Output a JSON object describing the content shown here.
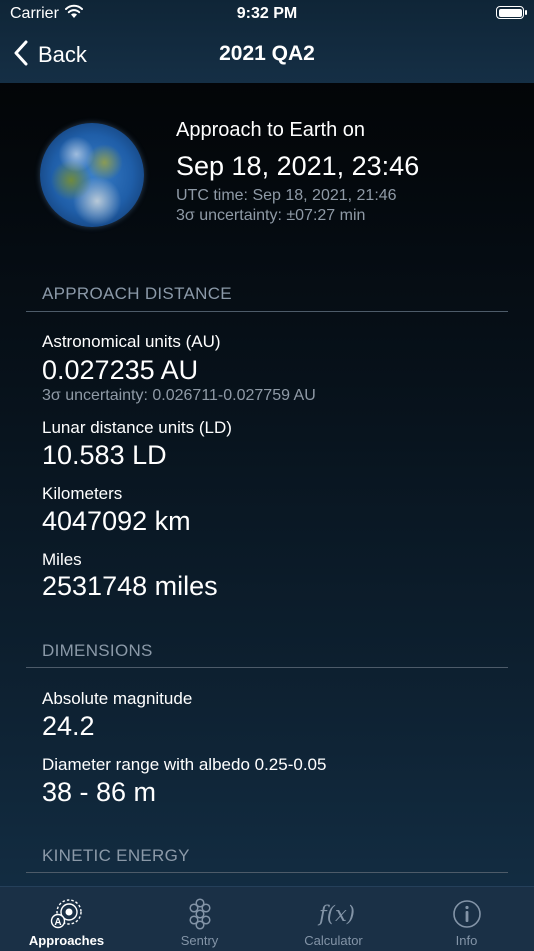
{
  "status_bar": {
    "carrier": "Carrier",
    "time": "9:32 PM"
  },
  "nav": {
    "back_label": "Back",
    "title": "2021 QA2"
  },
  "approach": {
    "label": "Approach to Earth on",
    "date": "Sep 18, 2021, 23:46",
    "utc": "UTC time: Sep 18, 2021, 21:46",
    "uncertainty": "3σ uncertainty: ±07:27 min"
  },
  "sections": {
    "distance": {
      "header": "APPROACH DISTANCE",
      "au_label": "Astronomical units (AU)",
      "au_value": "0.027235 AU",
      "au_uncertainty": "3σ uncertainty: 0.026711-0.027759 AU",
      "ld_label": "Lunar distance units (LD)",
      "ld_value": "10.583 LD",
      "km_label": "Kilometers",
      "km_value": "4047092 km",
      "mi_label": "Miles",
      "mi_value": "2531748 miles"
    },
    "dimensions": {
      "header": "DIMENSIONS",
      "mag_label": "Absolute magnitude",
      "mag_value": "24.2",
      "diam_label": "Diameter range with albedo  0.25-0.05",
      "diam_value": "38 - 86 m"
    },
    "energy": {
      "header": "KINETIC ENERGY"
    }
  },
  "tabs": [
    {
      "label": "Approaches",
      "icon": "approaches-icon",
      "active": true
    },
    {
      "label": "Sentry",
      "icon": "sentry-icon",
      "active": false
    },
    {
      "label": "Calculator",
      "icon": "calculator-icon",
      "active": false
    },
    {
      "label": "Info",
      "icon": "info-icon",
      "active": false
    }
  ],
  "colors": {
    "nav_background": "#152f45",
    "tab_background": "#1a3046",
    "secondary_text": "#8f9aa6",
    "section_header": "#8b99a8"
  }
}
